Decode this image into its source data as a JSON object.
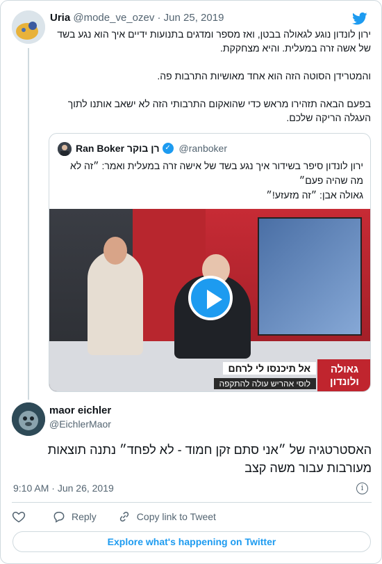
{
  "parent_tweet": {
    "name": "Uria",
    "handle": "@mode_ve_ozev",
    "separator": "·",
    "date": "Jun 25, 2019",
    "text_lines": [
      "ירון לונדון נוגע לגאולה בבטן, ואז מספר ומדגים בתנועות ידיים איך הוא נגע בשד",
      "של אשה זרה במעלית. והיא מצחקקת.",
      "",
      "והמטרידן הסוטה הזה הוא אחד מאושיות התרבות פה.",
      "",
      "בפעם הבאה תזהירו מראש כדי שהואקום התרבותי הזה לא ישאב אותנו לתוך",
      "העגלה הריקה שלכם."
    ]
  },
  "quote_tweet": {
    "name": "Ran Boker רן בוקר",
    "handle": "@ranboker",
    "text_lines": [
      "ירון לונדון סיפר בשידור איך נגע בשד של אישה זרה במעלית ואמר: ״זה לא",
      "מה שהיה פעם״",
      "גאולה אבן: ״זה מזעזע!״"
    ],
    "video": {
      "lower_third_line1": "אל תיכנסו לי לרחם",
      "lower_third_line2": "לוסי אהריש עולה להתקפה",
      "logo_line1": "גאולה",
      "logo_line2": "ולונדון"
    }
  },
  "main_tweet": {
    "name": "maor eichler",
    "handle": "@EichlerMaor",
    "text_lines": [
      "האסטרטגיה של ״אני סתם זקן חמוד - לא לפחד״ נתנה תוצאות",
      "מעורבות עבור משה קצב"
    ],
    "time": "9:10 AM",
    "date": "Jun 26, 2019",
    "time_separator": "·"
  },
  "actions": {
    "reply": "Reply",
    "copy_link": "Copy link to Tweet"
  },
  "explore_button": "Explore what's happening on Twitter",
  "colors": {
    "accent": "#1d9bf0",
    "text": "#0f1419",
    "muted": "#536471",
    "border": "#cfd9de"
  },
  "icons": [
    "twitter-bird-icon",
    "verified-badge-icon",
    "play-icon",
    "info-icon",
    "heart-icon",
    "reply-bubble-icon",
    "link-icon"
  ]
}
